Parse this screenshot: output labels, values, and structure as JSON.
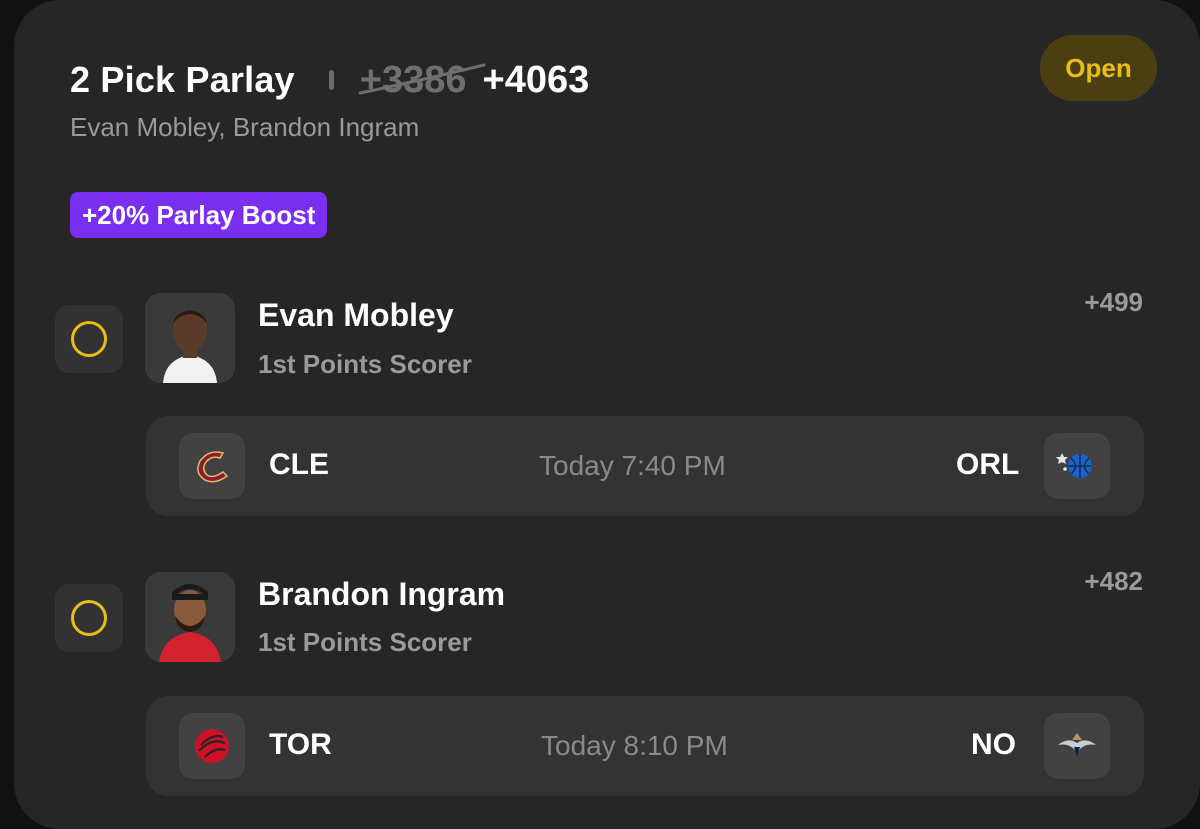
{
  "parlay": {
    "title": "2 Pick Parlay",
    "original_odds": "+3386",
    "boosted_odds": "+4063",
    "players_summary": "Evan Mobley, Brandon Ingram",
    "status": "Open",
    "boost_label": "+20% Parlay Boost"
  },
  "picks": [
    {
      "player": "Evan Mobley",
      "market": "1st Points Scorer",
      "odds": "+499",
      "game": {
        "away_team": "CLE",
        "home_team": "ORL",
        "time": "Today 7:40 PM",
        "away_logo": "cavaliers-logo-icon",
        "home_logo": "magic-logo-icon"
      }
    },
    {
      "player": "Brandon Ingram",
      "market": "1st Points Scorer",
      "odds": "+482",
      "game": {
        "away_team": "TOR",
        "home_team": "NO",
        "time": "Today 8:10 PM",
        "away_logo": "raptors-logo-icon",
        "home_logo": "pelicans-logo-icon"
      }
    }
  ],
  "colors": {
    "card_bg": "#262626",
    "status_yellow": "#e8be16",
    "boost_purple": "#7a2ff0",
    "muted_text": "#9a9a9a"
  }
}
